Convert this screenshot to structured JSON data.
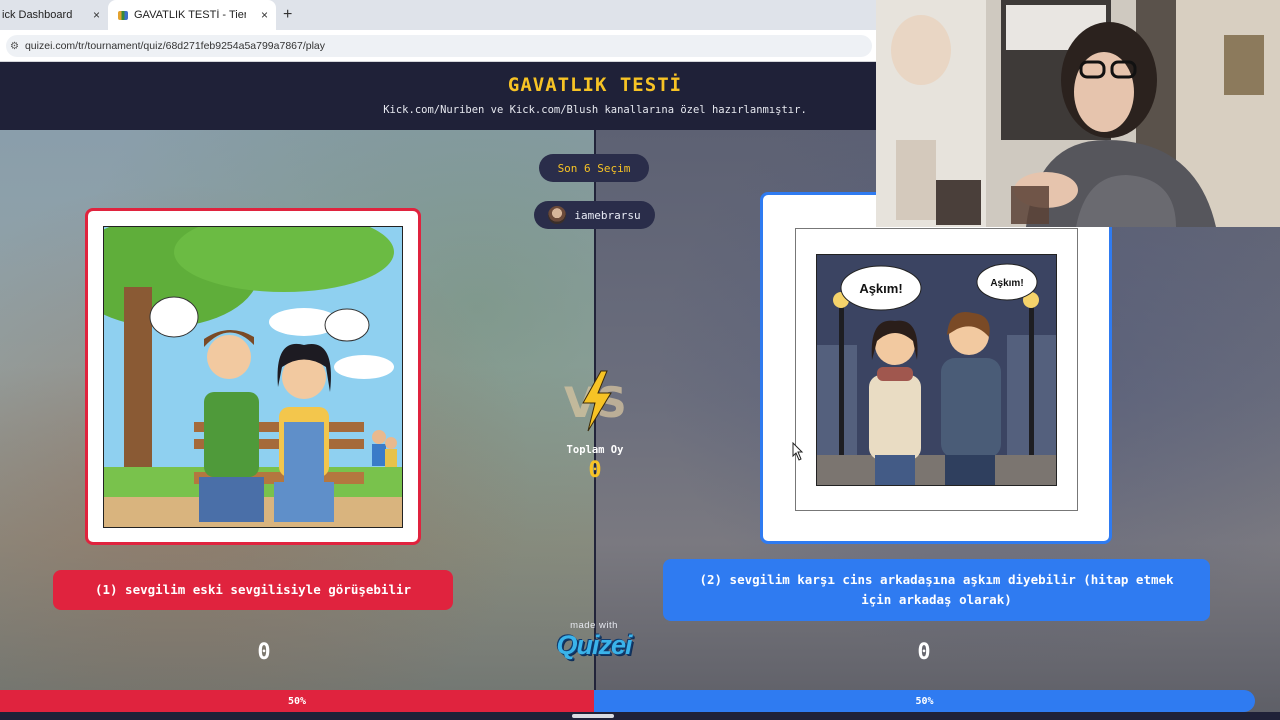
{
  "browser": {
    "tabs": [
      {
        "title": "ick Dashboard",
        "close": "×"
      },
      {
        "title": "GAVATLIK TESTİ - Tier List, Kör",
        "close": "×"
      }
    ],
    "new_tab": "+",
    "url": "quizei.com/tr/tournament/quiz/68d271feb9254a5a799a7867/play"
  },
  "quiz": {
    "title": "GAVATLIK TESTİ",
    "subtitle": "Kick.com/Nuriben ve Kick.com/Blush kanallarına özel hazırlanmıştır.",
    "recent_choices": "Son 6 Seçim",
    "username": "iamebrarsu",
    "vs": "VS",
    "total_label": "Toplam Oy",
    "total_votes": "0",
    "made_with": "made with",
    "brand": "Quizei"
  },
  "options": [
    {
      "label": "(1) sevgilim eski sevgilisiyle görüşebilir",
      "votes": "0",
      "percent_label": "50%",
      "share": 0.5,
      "color": "#e0233e"
    },
    {
      "label": "(2) sevgilim karşı cins arkadaşına aşkım diyebilir (hitap etmek için arkadaş olarak)",
      "votes": "0",
      "percent_label": "50%",
      "share": 0.5,
      "color": "#2f7bf1"
    }
  ],
  "illustration_right": {
    "bubble_left": "Aşkım!",
    "bubble_right": "Aşkım!"
  },
  "colors": {
    "accent": "#f7c325",
    "left": "#e0233e",
    "right": "#2f7bf1",
    "header": "#1f2138"
  }
}
